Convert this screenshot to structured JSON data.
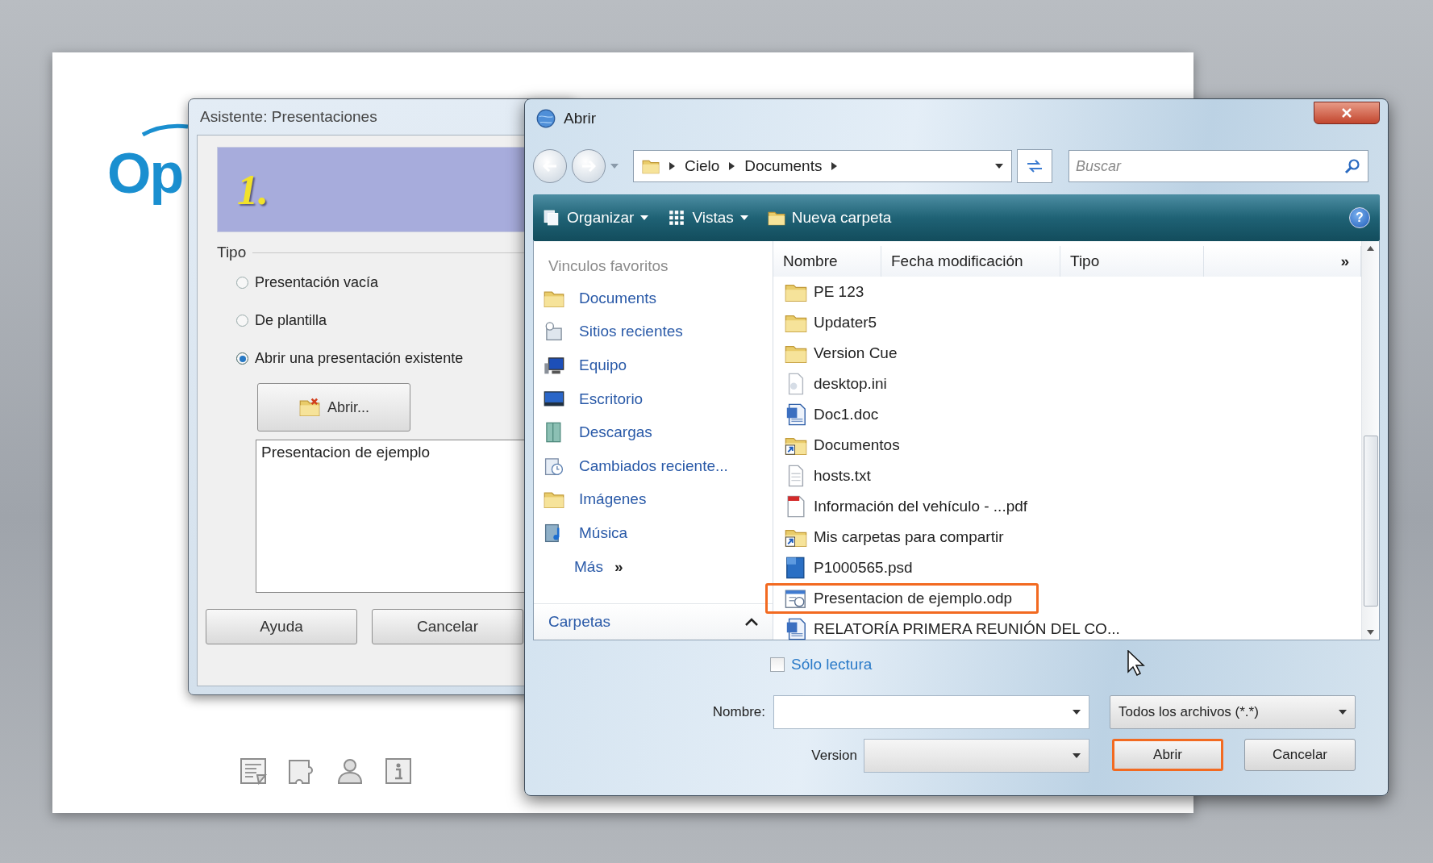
{
  "start_center": {
    "logo": "Op"
  },
  "wizard": {
    "title": "Asistente: Presentaciones",
    "step": "1.",
    "group_label": "Tipo",
    "options": [
      {
        "label": "Presentación vacía",
        "selected": false
      },
      {
        "label": "De plantilla",
        "selected": false
      },
      {
        "label": "Abrir una presentación existente",
        "selected": true
      }
    ],
    "open_button": "Abrir...",
    "preview": "Presentacion de ejemplo",
    "buttons": [
      "Ayuda",
      "Cancelar"
    ]
  },
  "open_dialog": {
    "title": "Abrir",
    "breadcrumb": [
      "Cielo",
      "Documents"
    ],
    "search": {
      "placeholder": "Buscar"
    },
    "toolbar": [
      {
        "label": "Organizar",
        "kind": "organize",
        "dropdown": true
      },
      {
        "label": "Vistas",
        "kind": "views",
        "dropdown": true
      },
      {
        "label": "Nueva carpeta",
        "kind": "new-folder",
        "dropdown": false
      }
    ],
    "help_button": "?",
    "favorites_header": "Vinculos favoritos",
    "favorites": [
      {
        "label": "Documents",
        "kind": "folder"
      },
      {
        "label": "Sitios recientes",
        "kind": "recent"
      },
      {
        "label": "Equipo",
        "kind": "computer"
      },
      {
        "label": "Escritorio",
        "kind": "desktop"
      },
      {
        "label": "Descargas",
        "kind": "downloads"
      },
      {
        "label": "Cambiados reciente...",
        "kind": "changed"
      },
      {
        "label": "Imágenes",
        "kind": "folder"
      },
      {
        "label": "Música",
        "kind": "music"
      }
    ],
    "more": {
      "label": "Más",
      "arrow": "»"
    },
    "folders_label": "Carpetas",
    "columns": [
      "Nombre",
      "Fecha modificación",
      "Tipo"
    ],
    "more_columns": "»",
    "files": [
      {
        "name": "PE 123",
        "kind": "folder",
        "highlighted": false
      },
      {
        "name": "Updater5",
        "kind": "folder",
        "highlighted": false
      },
      {
        "name": "Version Cue",
        "kind": "folder",
        "highlighted": false
      },
      {
        "name": "desktop.ini",
        "kind": "ini",
        "highlighted": false
      },
      {
        "name": "Doc1.doc",
        "kind": "doc",
        "highlighted": false
      },
      {
        "name": "Documentos",
        "kind": "shortcut",
        "highlighted": false
      },
      {
        "name": "hosts.txt",
        "kind": "txt",
        "highlighted": false
      },
      {
        "name": "Información del vehículo - ...pdf",
        "kind": "pdf",
        "highlighted": false
      },
      {
        "name": "Mis carpetas para compartir",
        "kind": "shortcut",
        "highlighted": false
      },
      {
        "name": "P1000565.psd",
        "kind": "psd",
        "highlighted": false
      },
      {
        "name": "Presentacion de ejemplo.odp",
        "kind": "odp",
        "highlighted": true
      },
      {
        "name": "RELATORÍA PRIMERA REUNIÓN DEL CO...",
        "kind": "doc",
        "highlighted": false
      }
    ],
    "read_only": {
      "label": "Sólo lectura",
      "checked": false
    },
    "name_label": "Nombre:",
    "file_type": "Todos los archivos (*.*)",
    "version_label": "Version",
    "buttons": [
      {
        "label": "Abrir",
        "highlighted": true
      },
      {
        "label": "Cancelar",
        "highlighted": false
      }
    ]
  }
}
